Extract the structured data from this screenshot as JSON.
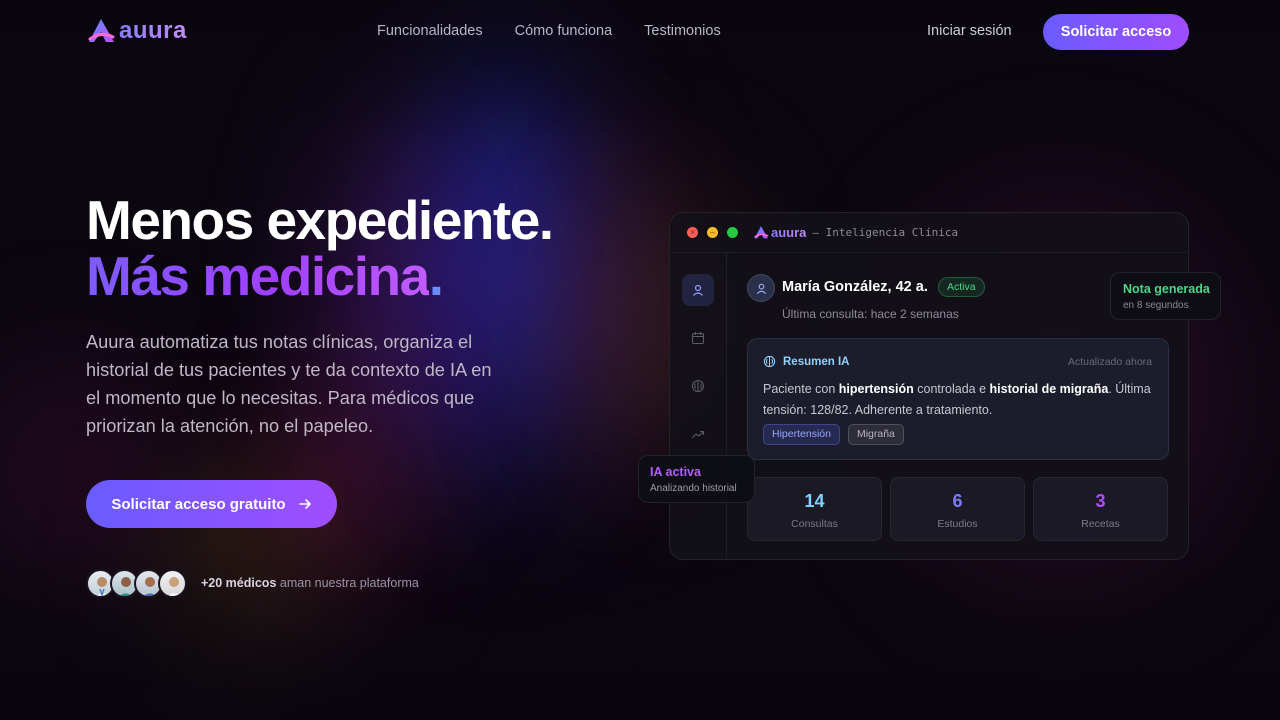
{
  "brand": {
    "name": "auura",
    "accent": "#7c5cff",
    "accent2": "#a04dff"
  },
  "nav": {
    "links": [
      "Funcionalidades",
      "Cómo funciona",
      "Testimonios"
    ],
    "login": "Iniciar sesión",
    "cta": "Solicitar acceso"
  },
  "hero": {
    "title_line1": "Menos expediente.",
    "title_line2": "Más medicina",
    "title_line2_dot": ".",
    "description": "Auura automatiza tus notas clínicas, organiza el historial de tus pacientes y te da contexto de IA en el momento que lo necesitas. Para médicos que priorizan la atención, no el papeleo.",
    "cta": "Solicitar acceso gratuito",
    "cta_icon": "arrow-right-icon",
    "social_count": "+20 médicos",
    "social_text": "aman nuestra plataforma"
  },
  "app": {
    "window_brand": "auura",
    "window_subtitle": "— Inteligencia Clínica",
    "sidebar_icons": [
      "user-icon",
      "calendar-icon",
      "brain-icon",
      "trend-icon"
    ],
    "patient": {
      "name": "María González, 42 a.",
      "status": "Activa",
      "last_visit": "Última consulta: hace 2 semanas"
    },
    "summary": {
      "title": "Resumen IA",
      "updated": "Actualizado ahora",
      "text_parts": {
        "p1": "Paciente con ",
        "b1": "hipertensión",
        "p2": " controlada e ",
        "b2": "historial de migraña",
        "p3": ". Última tensión: 128/82. Adherente a tratamiento."
      },
      "tags": [
        "Hipertensión",
        "Migraña"
      ]
    },
    "stats": [
      {
        "value": "14",
        "label": "Consultas",
        "color": "#7fd4ff"
      },
      {
        "value": "6",
        "label": "Estudios",
        "color": "#7b7bff"
      },
      {
        "value": "3",
        "label": "Recetas",
        "color": "#b14dff"
      }
    ]
  },
  "floating": {
    "note": {
      "title": "Nota generada",
      "subtitle": "en 8 segundos"
    },
    "ia": {
      "title": "IA activa",
      "subtitle": "Analizando historial"
    }
  }
}
